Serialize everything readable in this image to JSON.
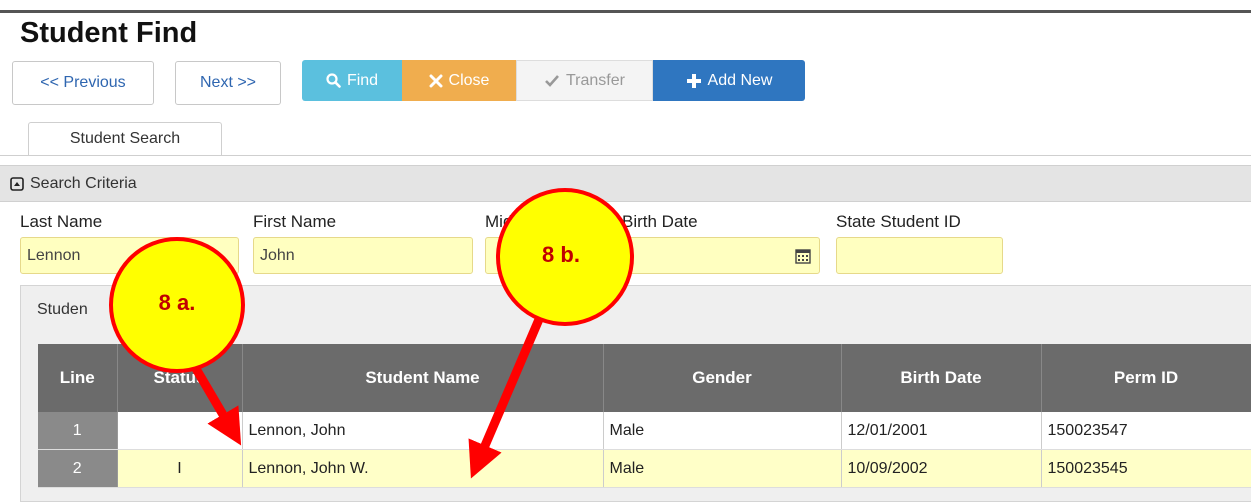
{
  "page": {
    "title": "Student Find"
  },
  "toolbar": {
    "previous_label": "<< Previous",
    "next_label": "Next >>",
    "find_label": "Find",
    "close_label": "Close",
    "transfer_label": "Transfer",
    "add_new_label": "Add New"
  },
  "tabs": [
    {
      "label": "Student Search"
    }
  ],
  "search": {
    "section_title": "Search Criteria",
    "last_name": {
      "label": "Last Name",
      "value": "Lennon"
    },
    "first_name": {
      "label": "First Name",
      "value": "John"
    },
    "middle_name": {
      "label": "Mid",
      "value": ""
    },
    "birth_date": {
      "label": "Birth Date",
      "value": ""
    },
    "state_student_id": {
      "label": "State Student ID",
      "value": ""
    }
  },
  "results": {
    "panel_title": "Studen",
    "columns": [
      "Line",
      "Status",
      "Student Name",
      "Gender",
      "Birth Date",
      "Perm ID"
    ],
    "rows": [
      {
        "line": "1",
        "status": "",
        "name": "Lennon, John",
        "gender": "Male",
        "birth_date": "12/01/2001",
        "perm_id": "150023547"
      },
      {
        "line": "2",
        "status": "I",
        "name": "Lennon, John W.",
        "gender": "Male",
        "birth_date": "10/09/2002",
        "perm_id": "150023545"
      }
    ]
  },
  "annotations": {
    "callout_a": "8 a.",
    "callout_b": "8 b."
  },
  "colors": {
    "find": "#5bc0de",
    "close": "#f0ad4e",
    "add_new": "#2f76c0",
    "input_bg": "#ffffc0",
    "header_bg": "#6b6b6b",
    "callout_fill": "#ffff00",
    "callout_border": "#ff0000"
  },
  "icons": [
    "search-icon",
    "close-x-icon",
    "checkmark-icon",
    "plus-icon",
    "collapse-icon",
    "calendar-icon"
  ]
}
